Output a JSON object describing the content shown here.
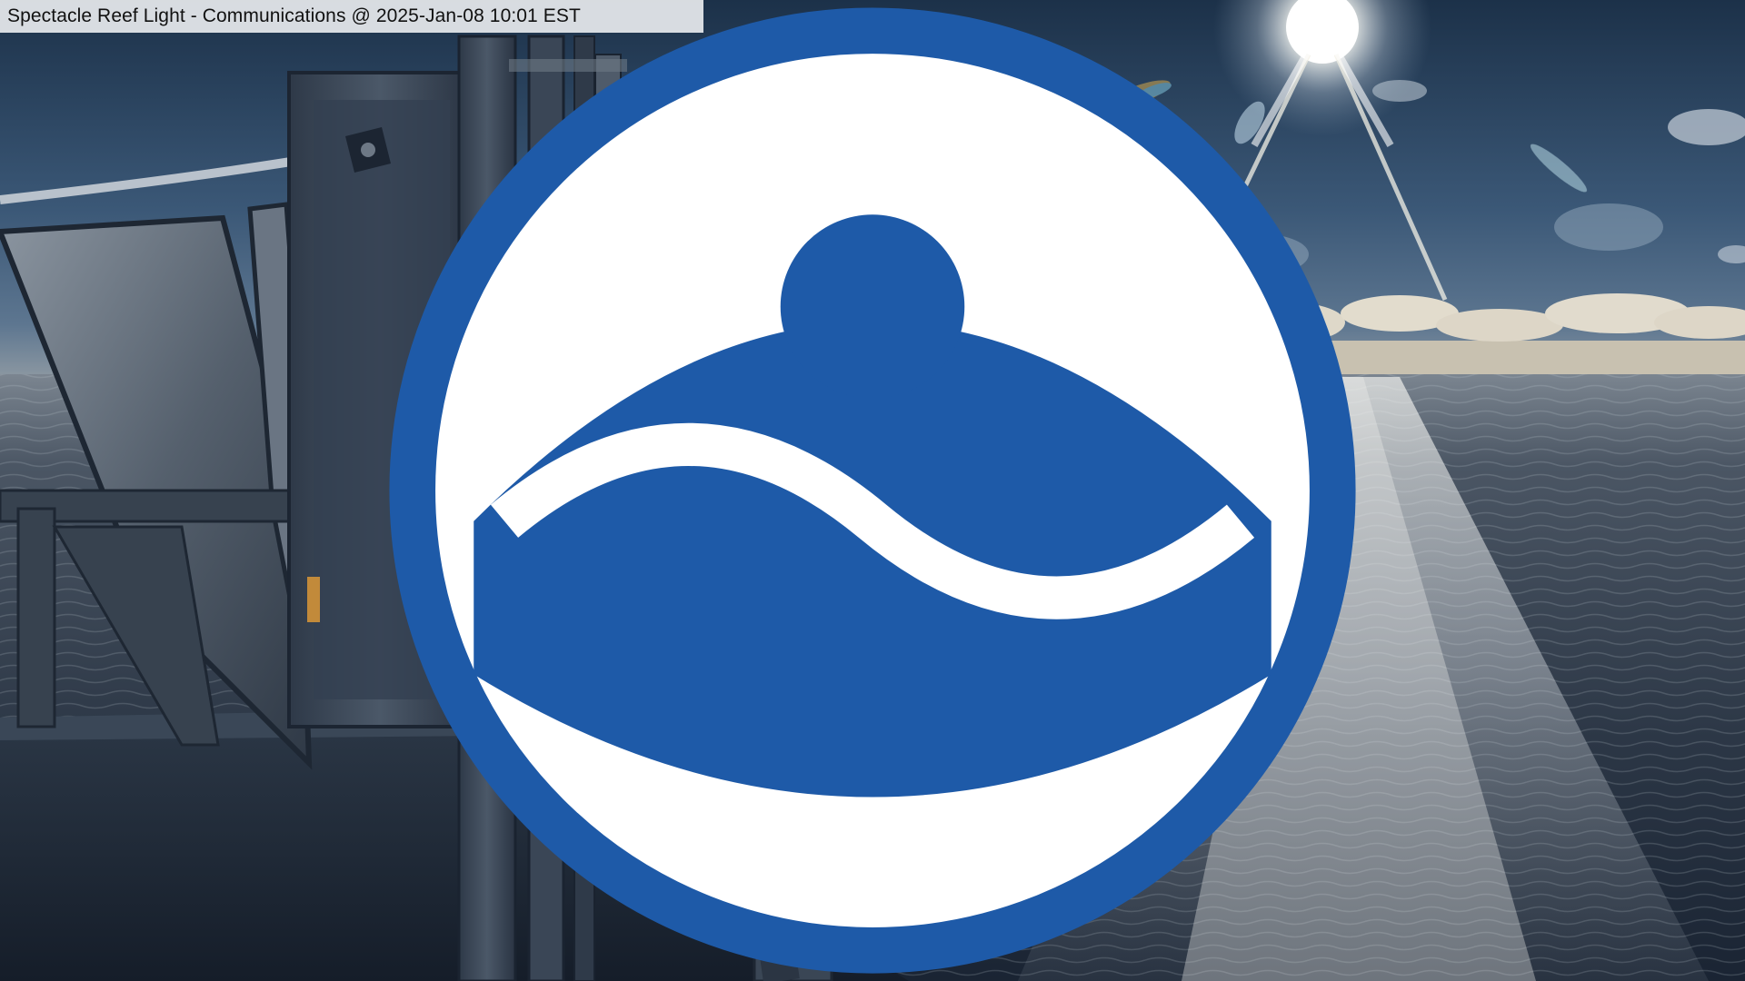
{
  "camera": {
    "caption": "Spectacle Reef Light - Communications @ 2025-Jan-08 10:01 EST",
    "logo": "noaa-logo-icon"
  },
  "colors": {
    "sky_top": "#1f3550",
    "sky_mid": "#3d5a78",
    "horizon": "#c9c2b2",
    "water_dark": "#1a2533",
    "water_glint": "#e8ecef",
    "structure": "#2a3544",
    "noaa_blue": "#1e5aa8"
  }
}
